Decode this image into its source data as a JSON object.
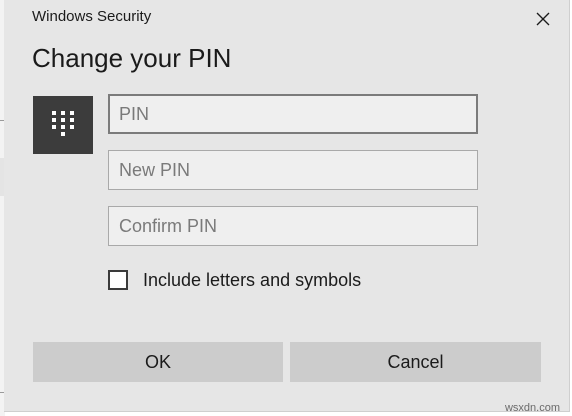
{
  "window": {
    "title": "Windows Security",
    "close_icon": "close-icon"
  },
  "dialog": {
    "heading": "Change your PIN",
    "keypad_icon": "keypad-icon",
    "fields": {
      "pin": {
        "value": "",
        "placeholder": "PIN"
      },
      "new_pin": {
        "value": "",
        "placeholder": "New PIN"
      },
      "confirm_pin": {
        "value": "",
        "placeholder": "Confirm PIN"
      }
    },
    "checkbox": {
      "label": "Include letters and symbols",
      "checked": false
    },
    "buttons": {
      "ok_label": "OK",
      "cancel_label": "Cancel"
    }
  },
  "watermark": {
    "text": "wsxdn.com"
  },
  "colors": {
    "dialog_bg": "#e6e6e6",
    "tile_bg": "#3c3c3c",
    "button_bg": "#cccccc",
    "field_bg": "#efefef"
  }
}
